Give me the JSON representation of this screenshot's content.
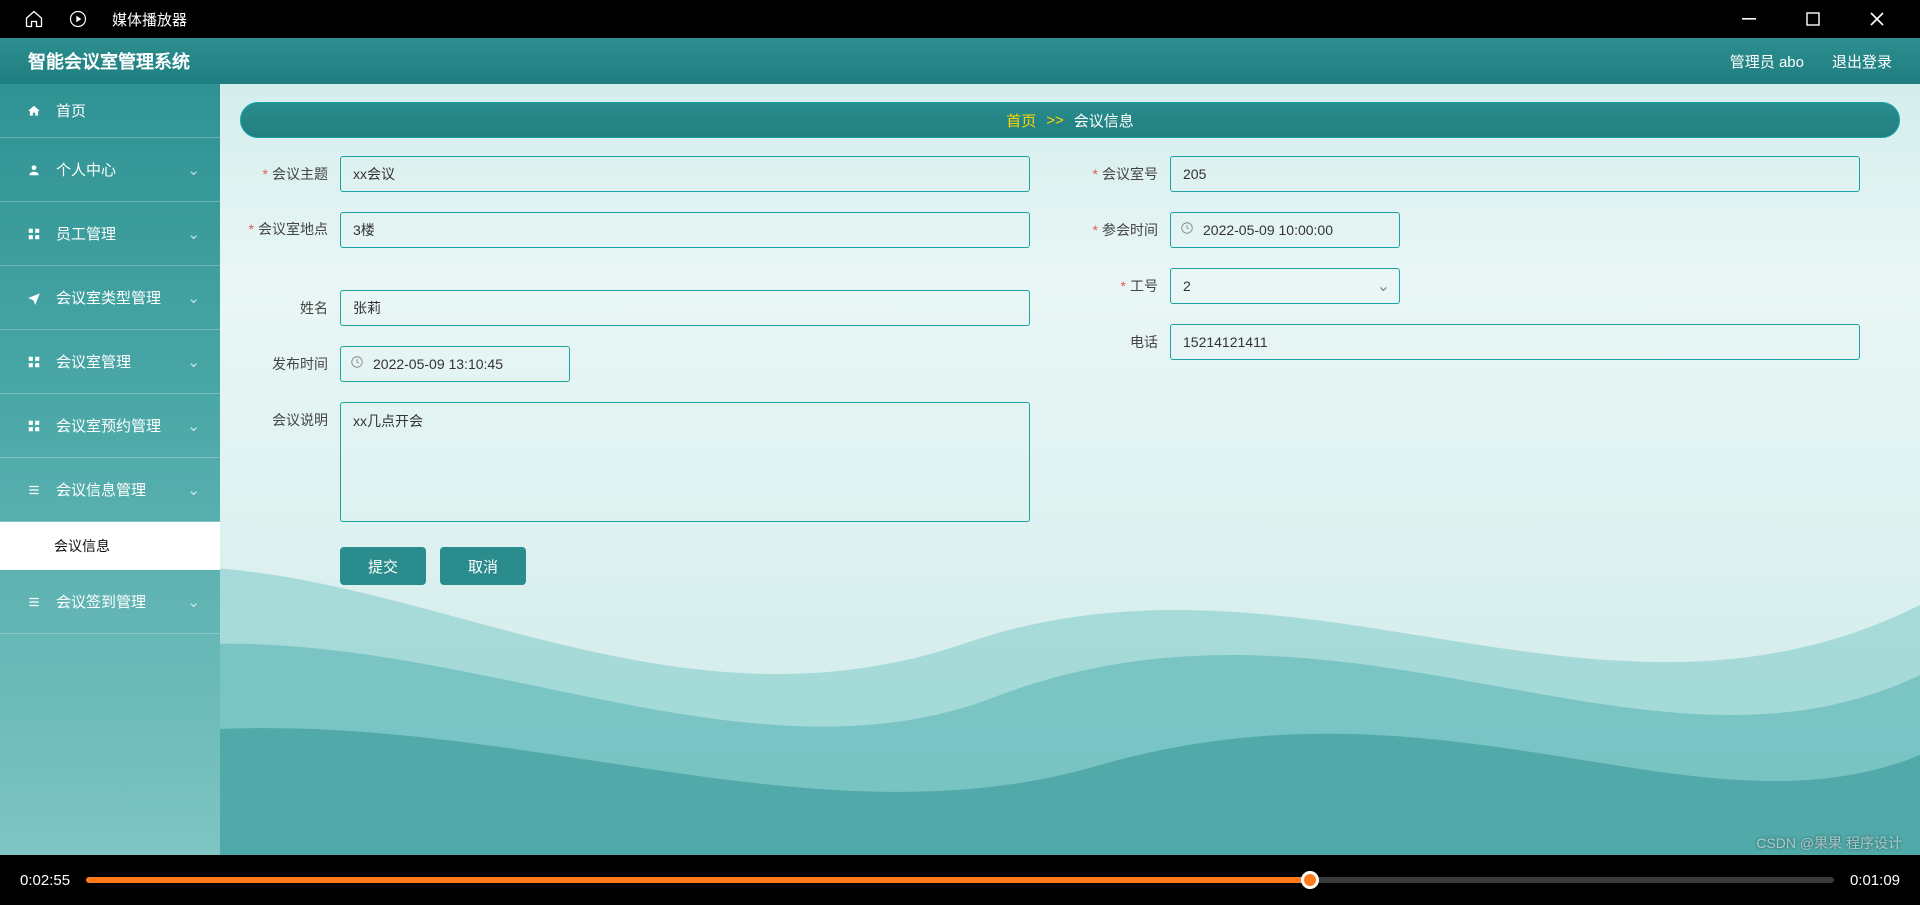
{
  "os": {
    "app_title": "媒体播放器"
  },
  "app": {
    "title": "智能会议室管理系统",
    "user_label": "管理员 abo",
    "logout": "退出登录"
  },
  "sidebar": {
    "items": [
      {
        "icon": "home",
        "label": "首页",
        "expandable": false
      },
      {
        "icon": "user",
        "label": "个人中心",
        "expandable": true
      },
      {
        "icon": "grid",
        "label": "员工管理",
        "expandable": true
      },
      {
        "icon": "plane",
        "label": "会议室类型管理",
        "expandable": true
      },
      {
        "icon": "grid",
        "label": "会议室管理",
        "expandable": true
      },
      {
        "icon": "grid",
        "label": "会议室预约管理",
        "expandable": true
      },
      {
        "icon": "menu",
        "label": "会议信息管理",
        "expandable": true,
        "open": true
      },
      {
        "icon": "menu",
        "label": "会议签到管理",
        "expandable": true
      }
    ],
    "sub_active": "会议信息"
  },
  "breadcrumb": {
    "home": "首页",
    "sep": ">>",
    "current": "会议信息"
  },
  "form": {
    "topic": {
      "label": "会议主题",
      "value": "xx会议",
      "required": true
    },
    "room_no": {
      "label": "会议室号",
      "value": "205",
      "required": true
    },
    "location": {
      "label": "会议室地点",
      "value": "3楼",
      "required": true
    },
    "attend_time": {
      "label": "参会时间",
      "value": "2022-05-09 10:00:00",
      "required": true
    },
    "emp_no": {
      "label": "工号",
      "value": "2",
      "required": true
    },
    "name": {
      "label": "姓名",
      "value": "张莉",
      "required": false
    },
    "phone": {
      "label": "电话",
      "value": "15214121411",
      "required": false
    },
    "publish_time": {
      "label": "发布时间",
      "value": "2022-05-09 13:10:45",
      "required": false
    },
    "desc": {
      "label": "会议说明",
      "value": "xx几点开会",
      "required": false
    },
    "submit": "提交",
    "cancel": "取消"
  },
  "player": {
    "elapsed": "0:02:55",
    "total": "0:01:09",
    "progress_pct": 70
  },
  "watermark": "CSDN @果果 程序设计"
}
